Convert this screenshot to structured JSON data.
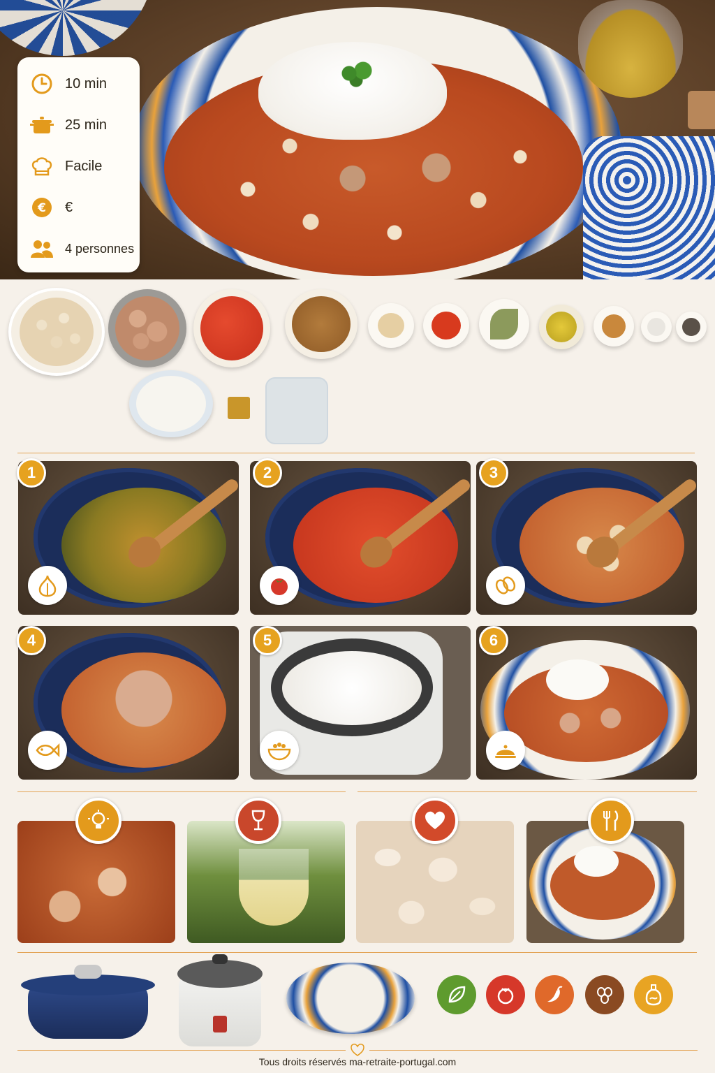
{
  "info": {
    "prep_time": "10 min",
    "cook_time": "25 min",
    "difficulty": "Facile",
    "cost": "€",
    "servings": "4 personnes",
    "icons": [
      "clock-icon",
      "pot-icon",
      "chef-hat-icon",
      "euro-coin-icon",
      "people-icon"
    ]
  },
  "ingredients": [
    "white-beans",
    "canned-tuna",
    "crushed-tomatoes",
    "fried-onions",
    "garlic-powder",
    "paprika",
    "bay-leaves",
    "olive-oil",
    "white-wine-vinegar",
    "salt",
    "black-pepper",
    "rice",
    "stock-cube",
    "water"
  ],
  "steps": [
    {
      "number": "1",
      "icon": "garlic-icon"
    },
    {
      "number": "2",
      "icon": "tomato-icon"
    },
    {
      "number": "3",
      "icon": "beans-icon"
    },
    {
      "number": "4",
      "icon": "fish-icon"
    },
    {
      "number": "5",
      "icon": "rice-bowl-icon"
    },
    {
      "number": "6",
      "icon": "serving-cloche-icon"
    }
  ],
  "tips": [
    {
      "icon": "lightbulb-icon",
      "color": "#e39a1c"
    },
    {
      "icon": "wine-glass-icon",
      "color": "#c9472b"
    },
    {
      "icon": "heart-icon",
      "color": "#d24a2a"
    },
    {
      "icon": "fork-knife-icon",
      "color": "#e39a1c"
    }
  ],
  "equipment": [
    "dutch-oven",
    "rice-cooker",
    "serving-plate"
  ],
  "badges": [
    {
      "icon": "leaf-icon",
      "color": "#5e9b2e"
    },
    {
      "icon": "tomato-icon",
      "color": "#d6382a"
    },
    {
      "icon": "chili-icon",
      "color": "#e0692a"
    },
    {
      "icon": "beans-icon",
      "color": "#8a4a22"
    },
    {
      "icon": "oil-bottle-icon",
      "color": "#e8a423"
    }
  ],
  "colors": {
    "accent": "#e6a21f",
    "background": "#f6f1ea",
    "blue": "#1e4fa3"
  },
  "footer": "Tous droits réservés ma-retraite-portugal.com"
}
